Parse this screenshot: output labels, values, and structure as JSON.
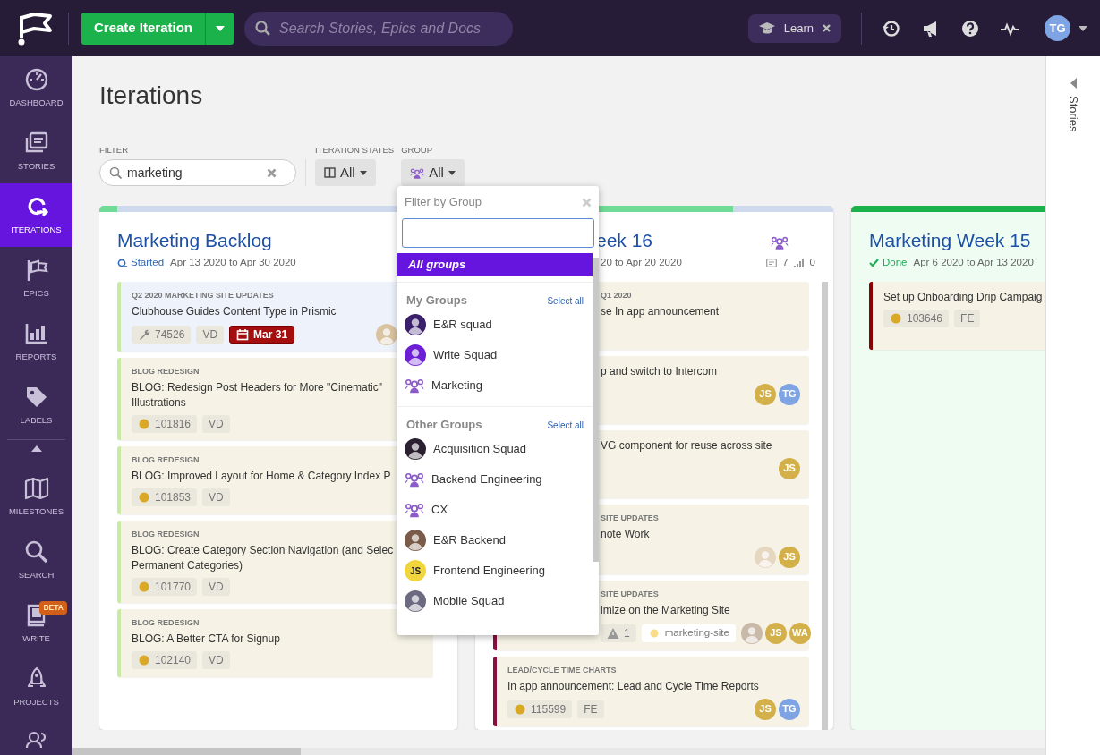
{
  "topbar": {
    "create_button": "Create Iteration",
    "search": {
      "placeholder": "Search Stories, Epics and Docs"
    },
    "learn": "Learn",
    "avatar": "TG"
  },
  "sidebar": {
    "items": [
      {
        "label": "DASHBOARD",
        "selected": false
      },
      {
        "label": "STORIES",
        "selected": false
      },
      {
        "label": "ITERATIONS",
        "selected": true
      },
      {
        "label": "EPICS",
        "selected": false
      },
      {
        "label": "REPORTS",
        "selected": false
      },
      {
        "label": "LABELS",
        "selected": false
      },
      {
        "label": "MILESTONES",
        "selected": false
      },
      {
        "label": "SEARCH",
        "selected": false
      },
      {
        "label": "WRITE",
        "selected": false,
        "badge": "BETA"
      },
      {
        "label": "PROJECTS",
        "selected": false
      }
    ]
  },
  "page": {
    "title": "Iterations",
    "filters": {
      "filter_label": "FILTER",
      "filter_value": "marketing",
      "states_label": "ITERATION STATES",
      "states_value": "All",
      "group_label": "GROUP",
      "group_value": "All"
    }
  },
  "columns": [
    {
      "title": "Marketing Backlog",
      "status": "Started",
      "kind": "started",
      "dates": "Apr 13 2020 to Apr 30 2020",
      "level": 0.05,
      "covered": false,
      "stories": [
        {
          "epic": "Q2 2020 MARKETING SITE UPDATES",
          "title": "Clubhouse Guides Content Type in Prismic",
          "color": "#c9eaa5",
          "highlighted": true,
          "covered": false,
          "tags": [
            {
              "kind": "id-wrench",
              "text": "74526"
            },
            {
              "kind": "owner",
              "text": "VD"
            },
            {
              "kind": "due",
              "text": "Mar 31"
            }
          ],
          "avatars": [
            {
              "kind": "image",
              "color": "#d9c3a0"
            }
          ]
        },
        {
          "epic": "BLOG REDESIGN",
          "title": "BLOG: Redesign Post Headers for More \"Cinematic\" Illustrations",
          "color": "#c9eaa5",
          "highlighted": false,
          "covered": false,
          "tags": [
            {
              "kind": "id",
              "text": "101816"
            },
            {
              "kind": "owner",
              "text": "VD"
            }
          ]
        },
        {
          "epic": "BLOG REDESIGN",
          "title": "BLOG: Improved Layout for Home & Category Index P",
          "color": "#c9eaa5",
          "highlighted": false,
          "covered": false,
          "tags": [
            {
              "kind": "id",
              "text": "101853"
            },
            {
              "kind": "owner",
              "text": "VD"
            }
          ]
        },
        {
          "epic": "BLOG REDESIGN",
          "title": "BLOG: Create Category Section Navigation (and Selec Permanent Categories)",
          "color": "#c9eaa5",
          "highlighted": false,
          "covered": false,
          "tags": [
            {
              "kind": "id",
              "text": "101770"
            },
            {
              "kind": "owner",
              "text": "VD"
            }
          ]
        },
        {
          "epic": "BLOG REDESIGN",
          "title": "BLOG: A Better CTA for Signup",
          "color": "#c9eaa5",
          "highlighted": false,
          "covered": false,
          "tags": [
            {
              "kind": "id",
              "text": "102140"
            },
            {
              "kind": "owner",
              "text": "VD"
            }
          ]
        }
      ]
    },
    {
      "title": "eek 16",
      "kind": "started",
      "dates": "20 to Apr 20 2020",
      "level": 0.72,
      "covered": true,
      "stats": [
        "7",
        "0"
      ],
      "stories": [
        {
          "epic": "Q1 2020",
          "title": "se In app announcement",
          "color": "#f6f3e6",
          "highlighted": false,
          "covered": true
        },
        {
          "title": "p and switch to Intercom",
          "color": "#f6f3e6",
          "highlighted": false,
          "covered": true,
          "avatars": [
            {
              "kind": "initials",
              "text": "JS",
              "color": "#d4b04a"
            },
            {
              "kind": "initials",
              "text": "TG",
              "color": "#7ea4e4"
            }
          ]
        },
        {
          "title": "VG component for reuse across site",
          "color": "#f6f3e6",
          "highlighted": false,
          "covered": true,
          "avatars": [
            {
              "kind": "initials",
              "text": "JS",
              "color": "#d4b04a"
            }
          ]
        },
        {
          "epic": "SITE UPDATES",
          "title": "note Work",
          "color": "#f6f3e6",
          "highlighted": false,
          "covered": true,
          "avatars": [
            {
              "kind": "image",
              "color": "#e6d8c0"
            },
            {
              "kind": "initials",
              "text": "JS",
              "color": "#d4b04a"
            }
          ]
        },
        {
          "epic": "SITE UPDATES",
          "title": "imize on the Marketing Site",
          "color": "#8a0f3e",
          "highlighted": false,
          "covered": true,
          "tags": [
            {
              "kind": "blocker",
              "text": "1"
            },
            {
              "kind": "label",
              "text": "marketing-site"
            }
          ],
          "avatars": [
            {
              "kind": "image",
              "color": "#c9b9a8"
            },
            {
              "kind": "initials",
              "text": "JS",
              "color": "#d4b04a"
            },
            {
              "kind": "initials",
              "text": "WA",
              "color": "#d4b04a"
            }
          ]
        },
        {
          "epic": "LEAD/CYCLE TIME CHARTS",
          "title": "In app announcement: Lead and Cycle Time Reports",
          "color": "#8a0f3e",
          "highlighted": false,
          "covered": false,
          "tags": [
            {
              "kind": "id",
              "text": "115599"
            },
            {
              "kind": "owner",
              "text": "FE"
            }
          ],
          "avatars": [
            {
              "kind": "initials",
              "text": "JS",
              "color": "#d4b04a"
            },
            {
              "kind": "initials",
              "text": "TG",
              "color": "#7ea4e4"
            }
          ]
        }
      ]
    },
    {
      "title": "Marketing Week 15",
      "status": "Done",
      "kind": "done",
      "dates": "Apr 6 2020 to Apr 13 2020",
      "level": 1,
      "covered": false,
      "stories": [
        {
          "title": "Set up Onboarding Drip Campaig",
          "color": "#8b0000",
          "highlighted": false,
          "covered": false,
          "tags": [
            {
              "kind": "id",
              "text": "103646"
            },
            {
              "kind": "owner",
              "text": "FE"
            }
          ]
        }
      ]
    }
  ],
  "group_menu": {
    "title": "Filter by Group",
    "options": [
      {
        "label": "All groups",
        "selected": true
      }
    ],
    "sections": [
      {
        "title": "My Groups",
        "action": "Select all",
        "groups": [
          {
            "label": "E&R squad",
            "kind": "image",
            "color": "#3a1f6b"
          },
          {
            "label": "Write Squad",
            "kind": "image",
            "color": "#6d1fd6"
          },
          {
            "label": "Marketing",
            "kind": "group"
          }
        ]
      },
      {
        "title": "Other Groups",
        "action": "Select all",
        "groups": [
          {
            "label": "Acquisition Squad",
            "kind": "image",
            "color": "#2a2030"
          },
          {
            "label": "Backend Engineering",
            "kind": "group"
          },
          {
            "label": "CX",
            "kind": "group"
          },
          {
            "label": "E&R Backend",
            "kind": "image",
            "color": "#7a5a48"
          },
          {
            "label": "Frontend Engineering",
            "kind": "initials",
            "text": "JS",
            "color": "#f0d53c"
          },
          {
            "label": "Mobile Squad",
            "kind": "image",
            "color": "#6b6a80"
          }
        ]
      }
    ]
  },
  "side_panel": {
    "label": "Stories"
  }
}
